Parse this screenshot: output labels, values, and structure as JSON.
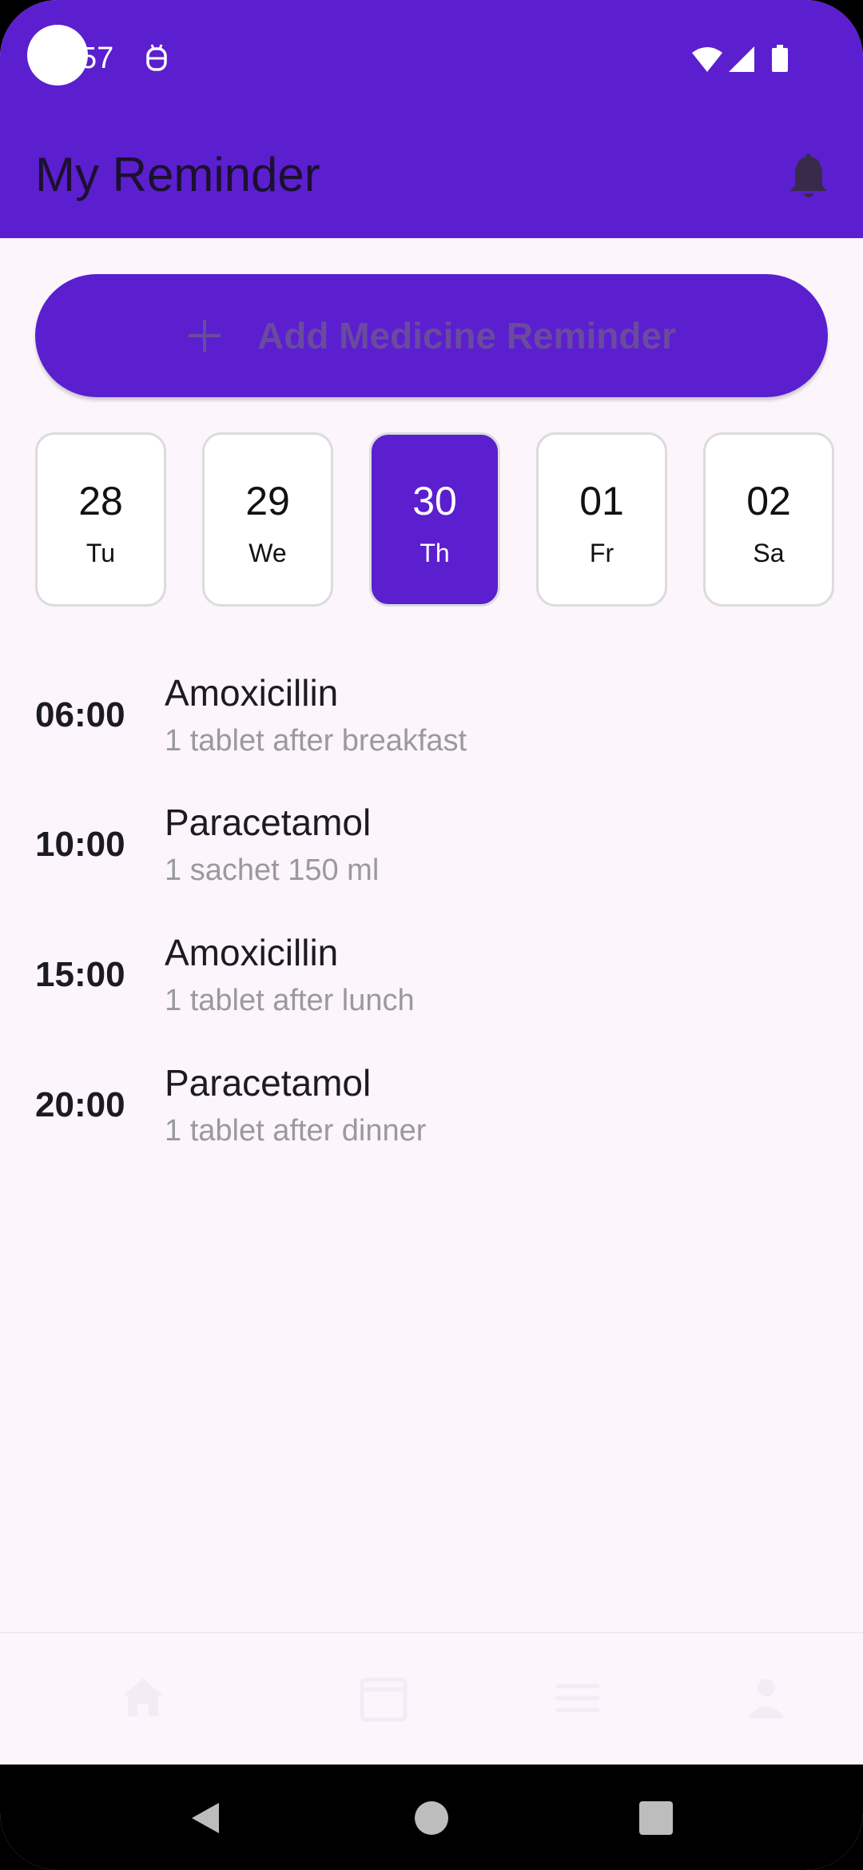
{
  "status_bar": {
    "time": "57"
  },
  "app_bar": {
    "title": "My Reminder",
    "notification_icon": "bell-icon"
  },
  "add_button": {
    "icon": "plus-icon",
    "label": "Add Medicine Reminder"
  },
  "dates": [
    {
      "num": "28",
      "day": "Tu",
      "selected": false
    },
    {
      "num": "29",
      "day": "We",
      "selected": false
    },
    {
      "num": "30",
      "day": "Th",
      "selected": true
    },
    {
      "num": "01",
      "day": "Fr",
      "selected": false
    },
    {
      "num": "02",
      "day": "Sa",
      "selected": false
    }
  ],
  "reminders": [
    {
      "time": "06:00",
      "name": "Amoxicillin",
      "note": "1 tablet after breakfast"
    },
    {
      "time": "10:00",
      "name": "Paracetamol",
      "note": "1 sachet 150 ml"
    },
    {
      "time": "15:00",
      "name": "Amoxicillin",
      "note": "1 tablet after lunch"
    },
    {
      "time": "20:00",
      "name": "Paracetamol",
      "note": "1 tablet after dinner"
    }
  ],
  "bottom_nav": {
    "items": [
      "home-icon",
      "calendar-icon",
      "list-icon",
      "profile-icon"
    ]
  },
  "colors": {
    "primary": "#5b1fcf",
    "background": "#fcf5fc",
    "muted_text": "#9a9a9a"
  }
}
